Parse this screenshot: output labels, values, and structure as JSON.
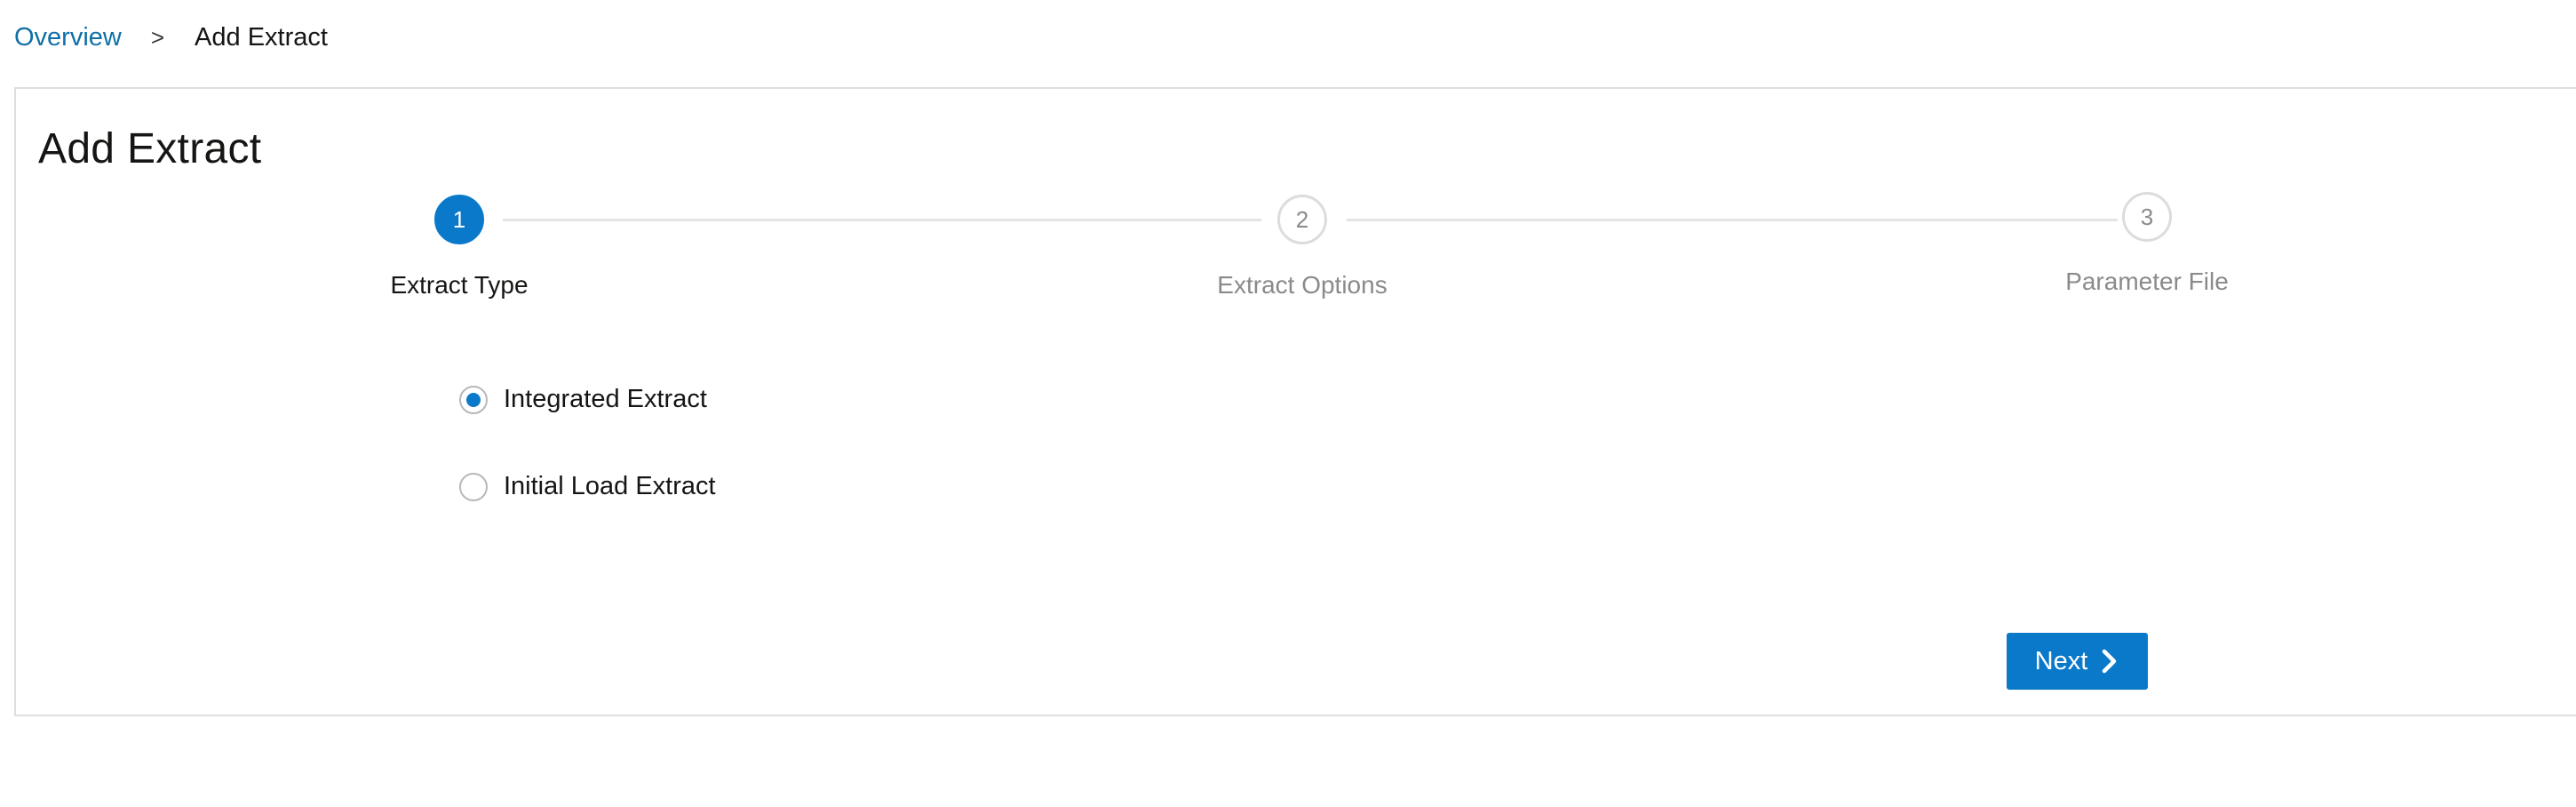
{
  "breadcrumb": {
    "parent_label": "Overview",
    "separator": ">",
    "current_label": "Add Extract"
  },
  "page": {
    "title": "Add Extract"
  },
  "train": {
    "steps": [
      {
        "number": "1",
        "label": "Extract Type",
        "state": "active"
      },
      {
        "number": "2",
        "label": "Extract Options",
        "state": "inactive"
      },
      {
        "number": "3",
        "label": "Parameter File",
        "state": "inactive"
      }
    ]
  },
  "extract_type": {
    "options": [
      {
        "label": "Integrated Extract",
        "selected": true
      },
      {
        "label": "Initial Load Extract",
        "selected": false
      }
    ]
  },
  "actions": {
    "next_label": "Next"
  },
  "colors": {
    "accent": "#0b79c9",
    "link": "#0f6fa8",
    "border": "#dedede",
    "inactive_text": "#8a8a8a"
  },
  "icons": {
    "next": "chevron-right-icon"
  }
}
